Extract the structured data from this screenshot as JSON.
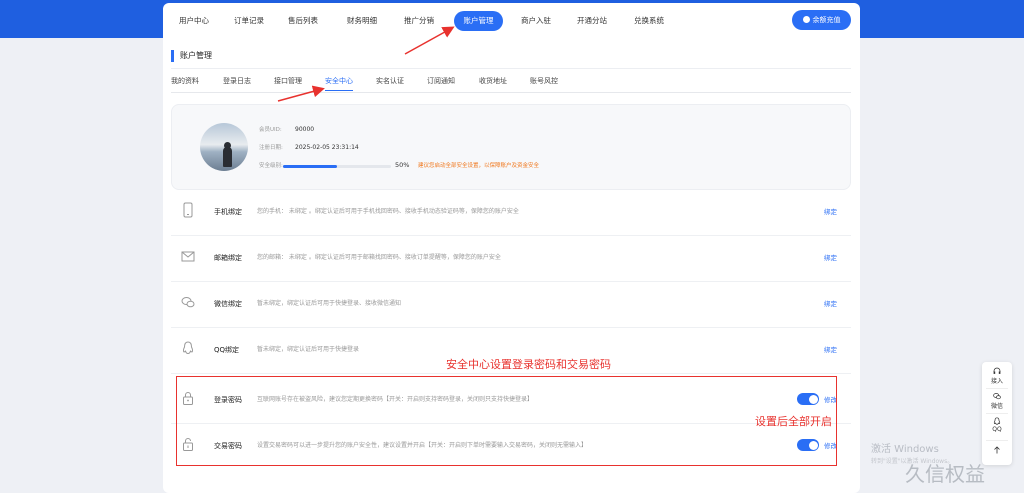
{
  "topnav": {
    "items": [
      "用户中心",
      "订单记录",
      "售后列表",
      "财务明细",
      "推广分销",
      "账户管理",
      "商户入驻",
      "开通分站",
      "兑换系统"
    ],
    "active_index": 5,
    "recharge_label": "余额充值"
  },
  "section_title": "账户管理",
  "tabs": {
    "items": [
      "我的资料",
      "登录日志",
      "接口管理",
      "安全中心",
      "实名认证",
      "订阅通知",
      "收货地址",
      "账号风控"
    ],
    "active_index": 3
  },
  "profile": {
    "uid_label": "会员UID:",
    "uid_value": "90000",
    "reg_label": "注册日期:",
    "reg_value": "2025-02-05 23:31:14",
    "level_label": "安全级别:",
    "progress": 0.5,
    "progress_text": "50%",
    "tip": "建议您启动全部安全设置，以保障账户及资金安全"
  },
  "security_rows": [
    {
      "icon": "phone-icon",
      "name": "手机绑定",
      "desc": "您的手机： 未绑定 。绑定认证后可用于手机找回密码、接收手机动态验证码等，保障您的账户安全",
      "action": "绑定"
    },
    {
      "icon": "mail-icon",
      "name": "邮箱绑定",
      "desc": "您的邮箱： 未绑定 。绑定认证后可用于邮箱找回密码、接收订单提醒等，保障您的账户安全",
      "action": "绑定"
    },
    {
      "icon": "wechat-icon",
      "name": "微信绑定",
      "desc": "暂未绑定，绑定认证后可用于快捷登录、接收微信通知",
      "action": "绑定"
    },
    {
      "icon": "qq-icon",
      "name": "QQ绑定",
      "desc": "暂未绑定，绑定认证后可用于快捷登录",
      "action": "绑定"
    },
    {
      "icon": "lock-icon",
      "name": "登录密码",
      "desc": "互联网账号存在被盗风险，建议您定期更换密码【开关：开启则支持密码登录，关闭则只支持快捷登录】",
      "action": "修改",
      "toggle": true
    },
    {
      "icon": "lock-open-icon",
      "name": "交易密码",
      "desc": "设置交易密码可以进一步提升您的账户安全性，建议设置并开启【开关：开启则下单时需要输入交易密码，关闭则无需输入】",
      "action": "修改",
      "toggle": true
    }
  ],
  "annotations": {
    "main": "安全中心设置登录密码和交易密码",
    "side": "设置后全部开启"
  },
  "sidebar": {
    "items": [
      "接入",
      "微信",
      "QQ"
    ]
  },
  "watermark": {
    "line1": "激活 Windows",
    "line2": "转到\"设置\"以激活 Windows。",
    "logo": "久信权益"
  },
  "colors": {
    "accent": "#2a6ef5",
    "topbar": "#1f5fe0",
    "annotation": "#e8322e",
    "tip": "#f0781e"
  }
}
